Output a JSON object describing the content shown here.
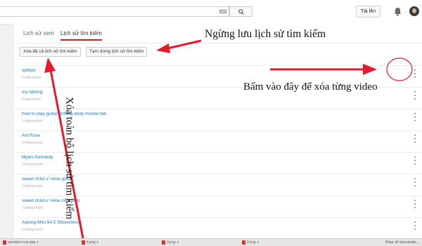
{
  "header": {
    "search_placeholder": "",
    "upload_label": "Tải lên",
    "icons": [
      "keyboard-icon",
      "search-icon",
      "bell-icon",
      "avatar"
    ]
  },
  "tabs": [
    {
      "label": "Lịch sử xem",
      "active": false
    },
    {
      "label": "Lịch sử tìm kiếm",
      "active": true
    }
  ],
  "actions": {
    "clear_all": "Xóa tất cả lịch sử tìm kiếm",
    "pause": "Tạm dừng lịch sử tìm kiếm"
  },
  "history": [
    {
      "title": "splitpic",
      "time": "2 tuần trước"
    },
    {
      "title": "my talking",
      "time": "4 tuần trước"
    },
    {
      "title": "how to play guitar drifting andy mckee tab",
      "time": "1 tháng trước"
    },
    {
      "title": "Axl Rose",
      "time": "1 tháng trước"
    },
    {
      "title": "Myles Kennedy",
      "time": "1 tháng trước"
    },
    {
      "title": "sweet child o' mine guitar",
      "time": "1 tháng trước"
    },
    {
      "title": "sweet child o' mine cifra club",
      "time": "1 tháng trước"
    },
    {
      "title": "Aolong Mini 54.5 Stickerless",
      "time": "1 tháng trước"
    }
  ],
  "downloads": {
    "items": [
      "question icon.png",
      "4.png",
      "3.png",
      "2.png"
    ],
    "show_all": "Show all downloads..."
  },
  "annotations": {
    "pause_note": "Ngừng lưu lịch sử tìm kiếm",
    "delete_each_note": "Bấm vào đây để xóa từng video",
    "clear_all_note": "Xóa toàn bộ lịch sử tìm kiếm",
    "arrow_color": "#e8192c"
  }
}
